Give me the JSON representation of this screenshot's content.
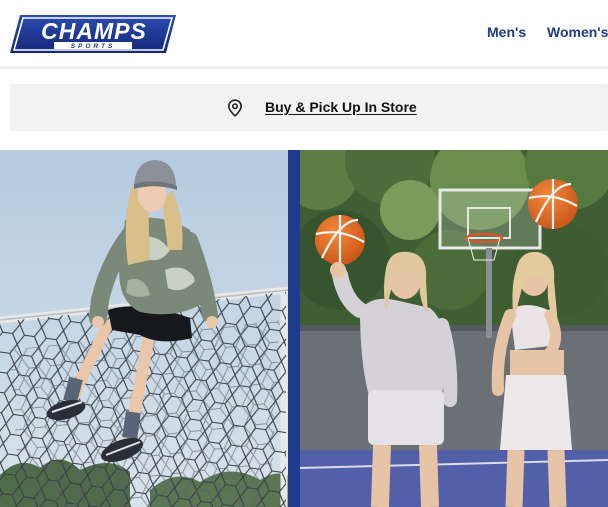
{
  "header": {
    "logo": {
      "primary_text": "CHAMPS",
      "secondary_text": "SPORTS",
      "alt": "Champs Sports"
    },
    "nav": [
      {
        "label": "Men's"
      },
      {
        "label": "Women's"
      }
    ]
  },
  "store_banner": {
    "icon": "map-pin-icon",
    "link_label": "Buy & Pick Up In Store"
  },
  "hero": {
    "left_image": "girl-sitting-on-soccer-goal",
    "right_image": "two-women-with-basketballs"
  },
  "colors": {
    "brand_blue": "#1d3a8a",
    "divider_blue": "#1f3c8c",
    "banner_bg": "#f2f2f2",
    "ball_orange": "#e2671d"
  }
}
